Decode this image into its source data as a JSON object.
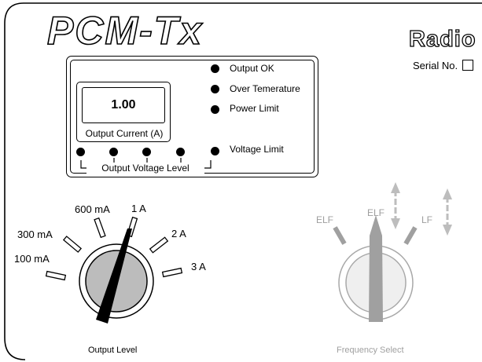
{
  "brand": {
    "model": "PCM-Tx",
    "company_partial": "Radio"
  },
  "serial": {
    "label": "Serial No."
  },
  "display": {
    "value": "1.00",
    "label": "Output Current (A)"
  },
  "indicators": [
    {
      "label": "Output OK"
    },
    {
      "label": "Over Temerature"
    },
    {
      "label": "Power Limit"
    },
    {
      "label": "Voltage Limit"
    }
  ],
  "voltage_level": {
    "label": "Output Voltage Level",
    "dot_count": 4
  },
  "output_level": {
    "label": "Output  Level",
    "positions": [
      "100 mA",
      "300 mA",
      "600 mA",
      "1 A",
      "2 A",
      "3 A"
    ],
    "selected": "1 A"
  },
  "frequency": {
    "label": "Frequency  Select",
    "options": [
      "ELF",
      "ELF",
      "LF"
    ],
    "selected_index": 1,
    "colors": {
      "inactive": "#a0a0a0",
      "arrows": "#bdbdbd"
    }
  }
}
